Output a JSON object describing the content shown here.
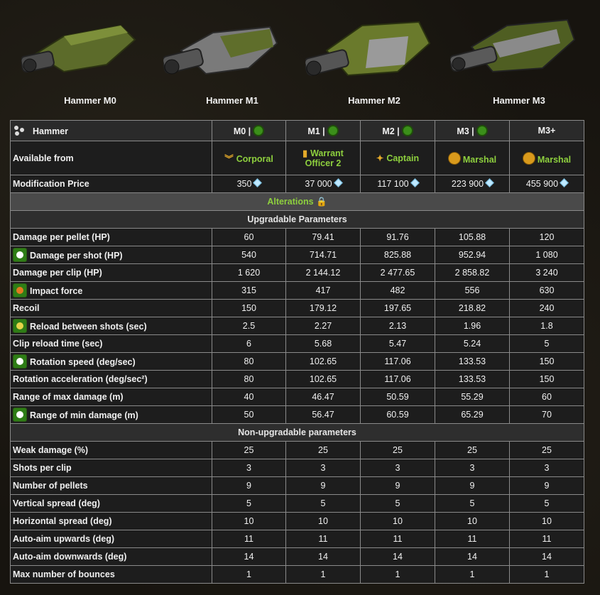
{
  "guns": [
    {
      "name": "Hammer M0",
      "icon": "hammer-m0-turret-icon"
    },
    {
      "name": "Hammer M1",
      "icon": "hammer-m1-turret-icon"
    },
    {
      "name": "Hammer M2",
      "icon": "hammer-m2-turret-icon"
    },
    {
      "name": "Hammer M3",
      "icon": "hammer-m3-turret-icon"
    }
  ],
  "table": {
    "title": "Hammer",
    "columns": [
      "M0 |",
      "M1 |",
      "M2 |",
      "M3 |",
      "M3+"
    ],
    "available_label": "Available from",
    "ranks": [
      "Corporal",
      "Warrant Officer 2",
      "Captain",
      "Marshal",
      "Marshal"
    ],
    "price_label": "Modification Price",
    "prices": [
      "350",
      "37 000",
      "117 100",
      "223 900",
      "455 900"
    ],
    "alterations_label": "Alterations",
    "upgradable_title": "Upgradable Parameters",
    "upgradable": [
      {
        "label": "Damage per pellet (HP)",
        "values": [
          "60",
          "79.41",
          "91.76",
          "105.88",
          "120"
        ]
      },
      {
        "label": "Damage per shot (HP)",
        "values": [
          "540",
          "714.71",
          "825.88",
          "952.94",
          "1 080"
        ],
        "icon": "damage-icon"
      },
      {
        "label": "Damage per clip (HP)",
        "values": [
          "1 620",
          "2 144.12",
          "2 477.65",
          "2 858.82",
          "3 240"
        ]
      },
      {
        "label": "Impact force",
        "values": [
          "315",
          "417",
          "482",
          "556",
          "630"
        ],
        "icon": "impact-icon"
      },
      {
        "label": "Recoil",
        "values": [
          "150",
          "179.12",
          "197.65",
          "218.82",
          "240"
        ]
      },
      {
        "label": "Reload between shots (sec)",
        "values": [
          "2.5",
          "2.27",
          "2.13",
          "1.96",
          "1.8"
        ],
        "icon": "reload-icon"
      },
      {
        "label": "Clip reload time (sec)",
        "values": [
          "6",
          "5.68",
          "5.47",
          "5.24",
          "5"
        ]
      },
      {
        "label": "Rotation speed (deg/sec)",
        "values": [
          "80",
          "102.65",
          "117.06",
          "133.53",
          "150"
        ],
        "icon": "rotation-icon"
      },
      {
        "label": "Rotation acceleration (deg/sec²)",
        "values": [
          "80",
          "102.65",
          "117.06",
          "133.53",
          "150"
        ]
      },
      {
        "label": "Range of max damage (m)",
        "values": [
          "40",
          "46.47",
          "50.59",
          "55.29",
          "60"
        ]
      },
      {
        "label": "Range of min damage (m)",
        "values": [
          "50",
          "56.47",
          "60.59",
          "65.29",
          "70"
        ],
        "icon": "range-icon"
      }
    ],
    "nonupgradable_title": "Non-upgradable parameters",
    "nonupgradable": [
      {
        "label": "Weak damage (%)",
        "values": [
          "25",
          "25",
          "25",
          "25",
          "25"
        ]
      },
      {
        "label": "Shots per clip",
        "values": [
          "3",
          "3",
          "3",
          "3",
          "3"
        ]
      },
      {
        "label": "Number of pellets",
        "values": [
          "9",
          "9",
          "9",
          "9",
          "9"
        ]
      },
      {
        "label": "Vertical spread (deg)",
        "values": [
          "5",
          "5",
          "5",
          "5",
          "5"
        ]
      },
      {
        "label": "Horizontal spread (deg)",
        "values": [
          "10",
          "10",
          "10",
          "10",
          "10"
        ]
      },
      {
        "label": "Auto-aim upwards (deg)",
        "values": [
          "11",
          "11",
          "11",
          "11",
          "11"
        ]
      },
      {
        "label": "Auto-aim downwards (deg)",
        "values": [
          "14",
          "14",
          "14",
          "14",
          "14"
        ]
      },
      {
        "label": "Max number of bounces",
        "values": [
          "1",
          "1",
          "1",
          "1",
          "1"
        ]
      }
    ]
  }
}
